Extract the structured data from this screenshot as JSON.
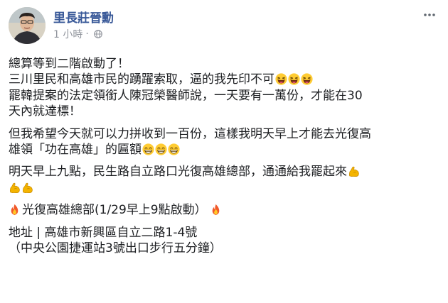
{
  "post": {
    "author": "里長莊晉勳",
    "time": "1 小時",
    "separator": "·",
    "privacy_icon": "globe-icon",
    "more_icon": "ellipsis-icon",
    "body": {
      "p1_l1": "總算等到二階啟動了！",
      "p1_l2": "三川里民和高雄市民的踴躍索取，逼的我先印不可",
      "p1_l3": "罷韓提案的法定領銜人陳冠榮醫師說，一天要有一萬份，才能在30",
      "p1_l4": "天內就達標！",
      "p2_l1": "但我希望今天就可以力拼收到一百份，這樣我明天早上才能去光復高",
      "p2_l2": "雄領「功在高雄」的匾額",
      "p3_l1": "明天早上九點，民生路自立路口光復高雄總部，通通給我罷起來",
      "p4_l1": "光復高雄總部(1/29早上9點啟動）",
      "p5_l1": "地址 | 高雄市新興區自立二路1-4號",
      "p5_l2": "（中央公園捷運站3號出口步行五分鐘）"
    },
    "emoji": {
      "laughing": "laughing-face-emoji",
      "grinning": "grinning-face-emoji",
      "flexed_biceps": "flexed-biceps-emoji",
      "fire": "fire-emoji"
    },
    "colors": {
      "author_link": "#385898",
      "meta_gray": "#90949c",
      "text": "#1c1e21"
    }
  }
}
